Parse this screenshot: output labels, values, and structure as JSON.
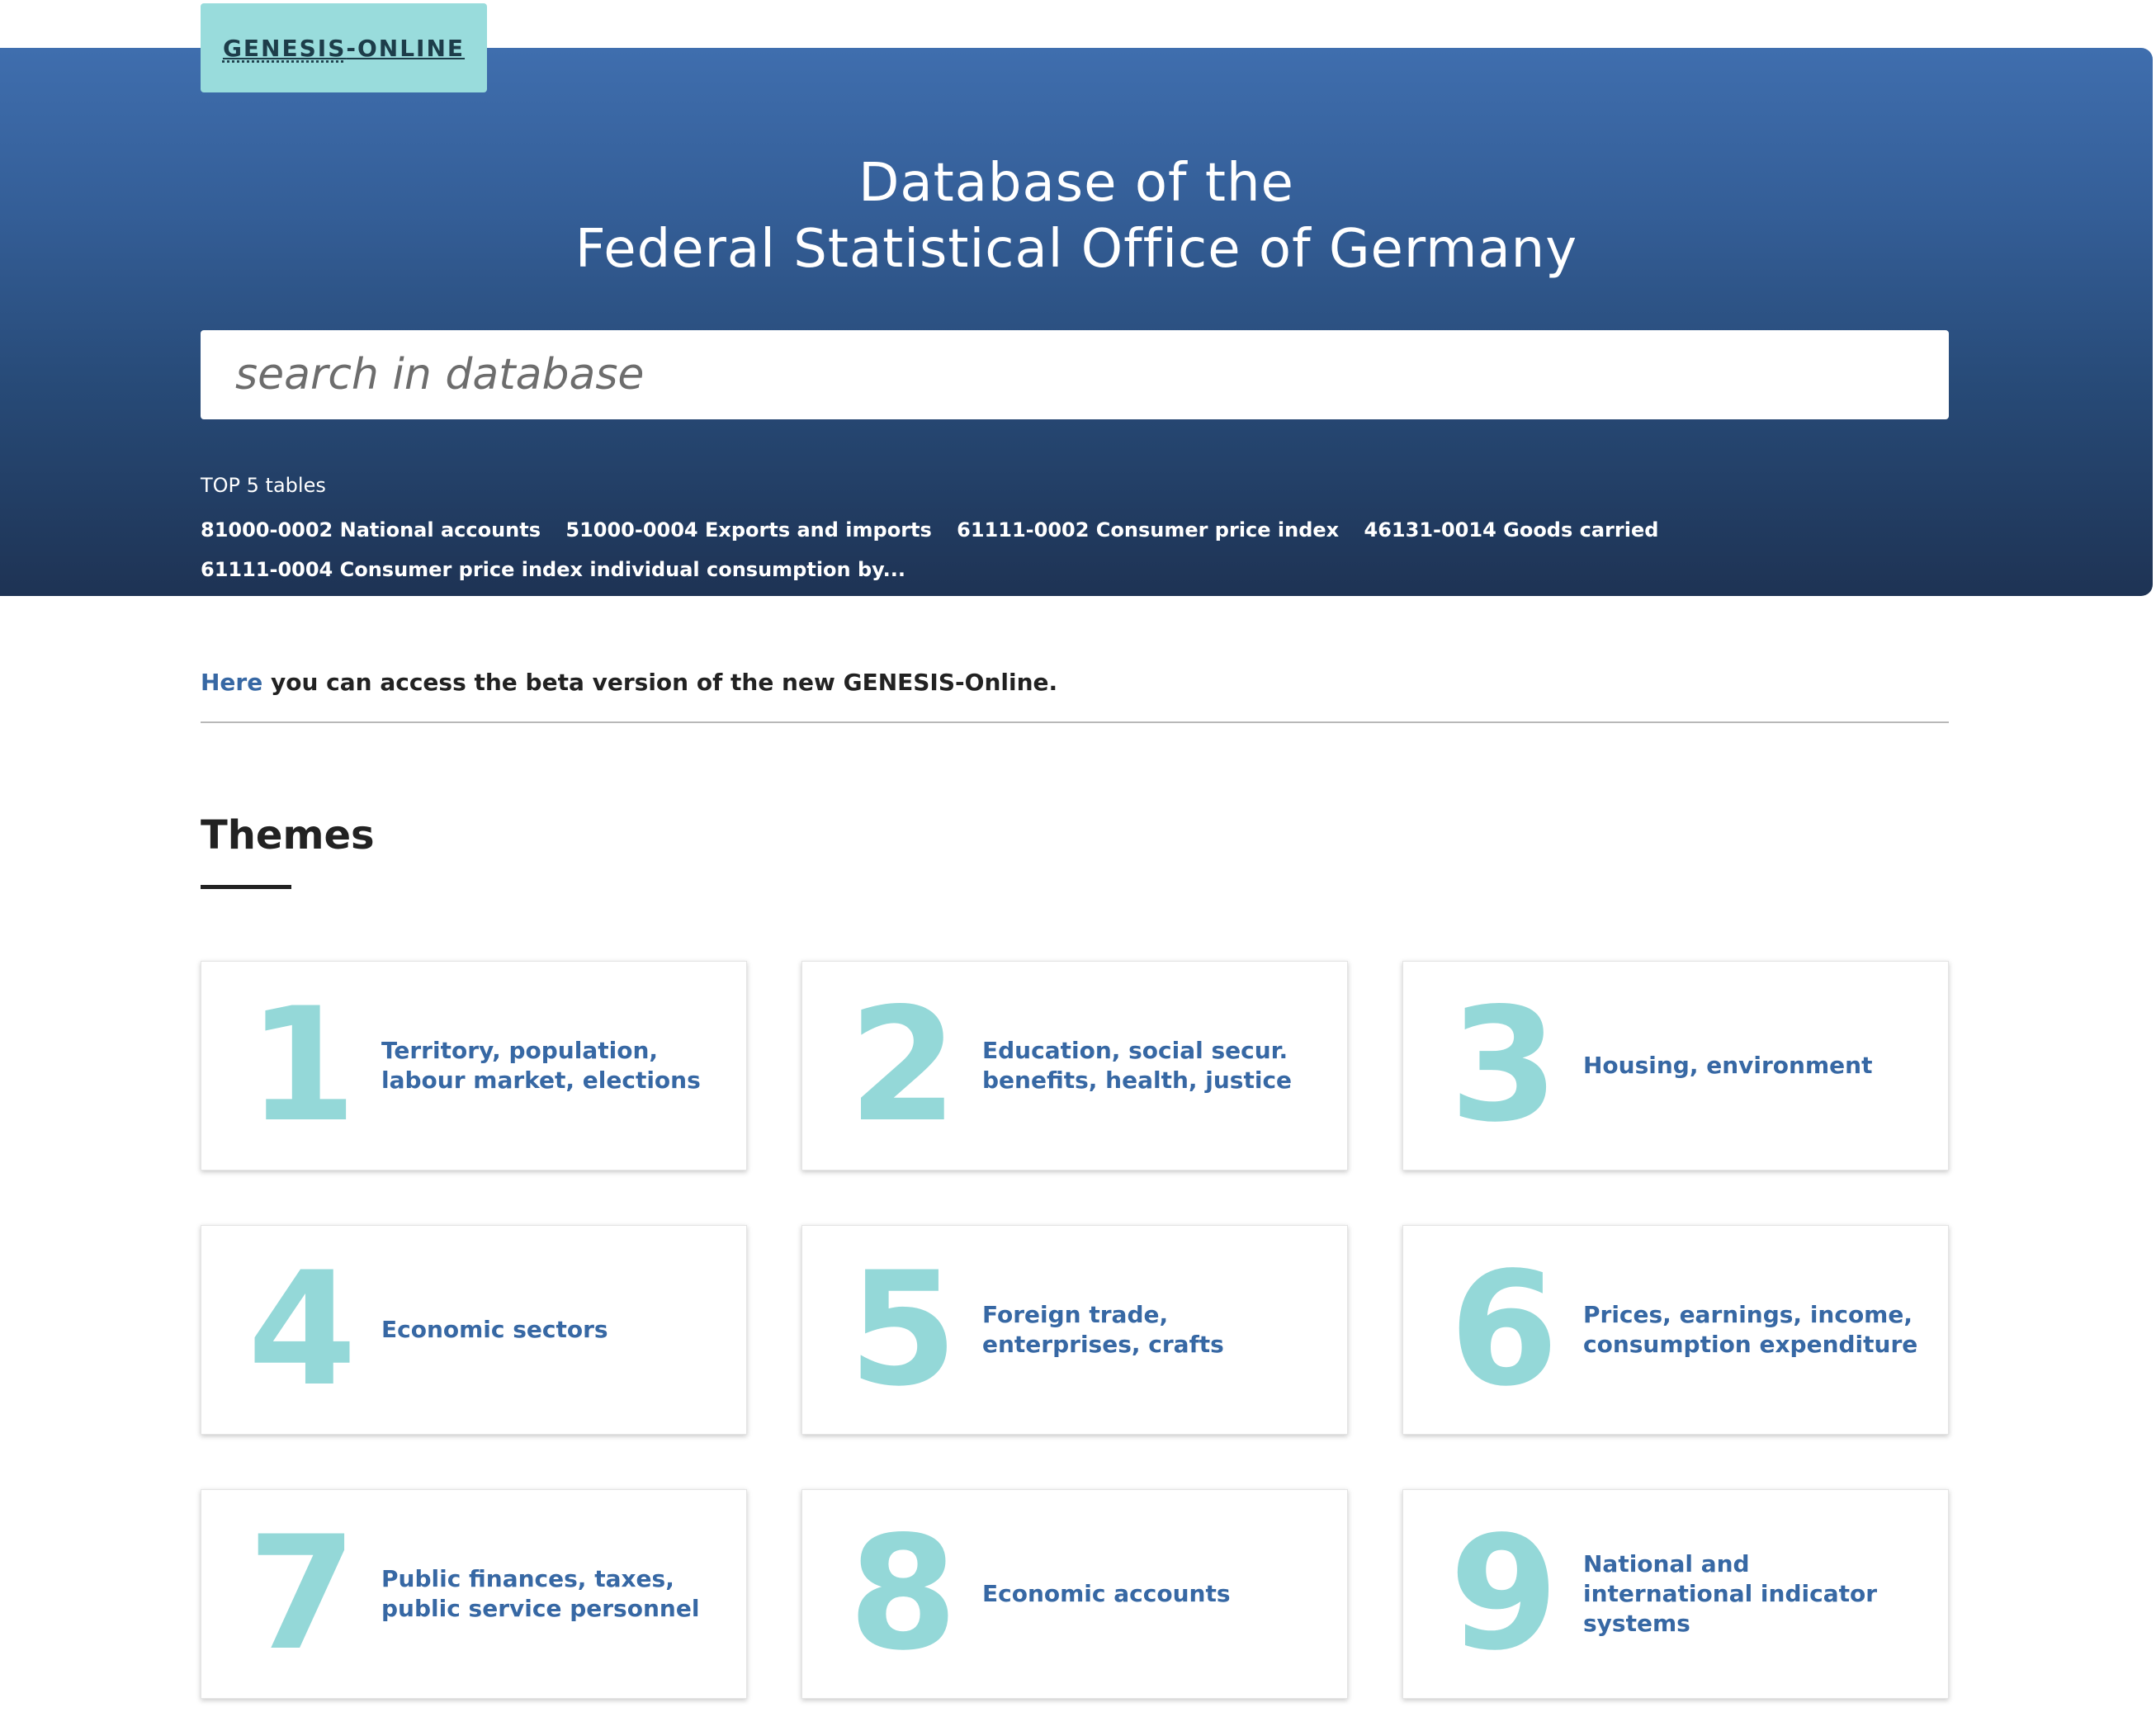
{
  "logo": {
    "abbr": "GENESIS",
    "rest": "-ONLINE"
  },
  "hero": {
    "title_line1": "Database of the",
    "title_line2": "Federal Statistical Office of Germany"
  },
  "search": {
    "placeholder": "search in database"
  },
  "top5": {
    "label": "TOP 5 tables",
    "links": [
      "81000-0002 National accounts",
      "51000-0004 Exports and imports",
      "61111-0002 Consumer price index",
      "46131-0014 Goods carried",
      "61111-0004 Consumer price index individual consumption by..."
    ]
  },
  "beta": {
    "link": "Here",
    "text": " you can access the beta version of the new GENESIS-Online."
  },
  "themes": {
    "title": "Themes",
    "items": [
      {
        "num": "1",
        "label": "Territory, population, labour market, elections"
      },
      {
        "num": "2",
        "label": "Education, social secur. benefits, health, justice"
      },
      {
        "num": "3",
        "label": "Housing, environment"
      },
      {
        "num": "4",
        "label": "Economic sectors"
      },
      {
        "num": "5",
        "label": "Foreign trade, enterprises, crafts"
      },
      {
        "num": "6",
        "label": "Prices, earnings, income, consumption expenditure"
      },
      {
        "num": "7",
        "label": "Public finances, taxes, public service personnel"
      },
      {
        "num": "8",
        "label": "Economic accounts"
      },
      {
        "num": "9",
        "label": "National and international indicator systems"
      }
    ]
  },
  "colors": {
    "header_top": "#3f6eae",
    "header_bottom": "#1e3354",
    "logo_bg": "#99dcdc",
    "link": "#3768a4",
    "theme_number": "#94d8d8"
  }
}
